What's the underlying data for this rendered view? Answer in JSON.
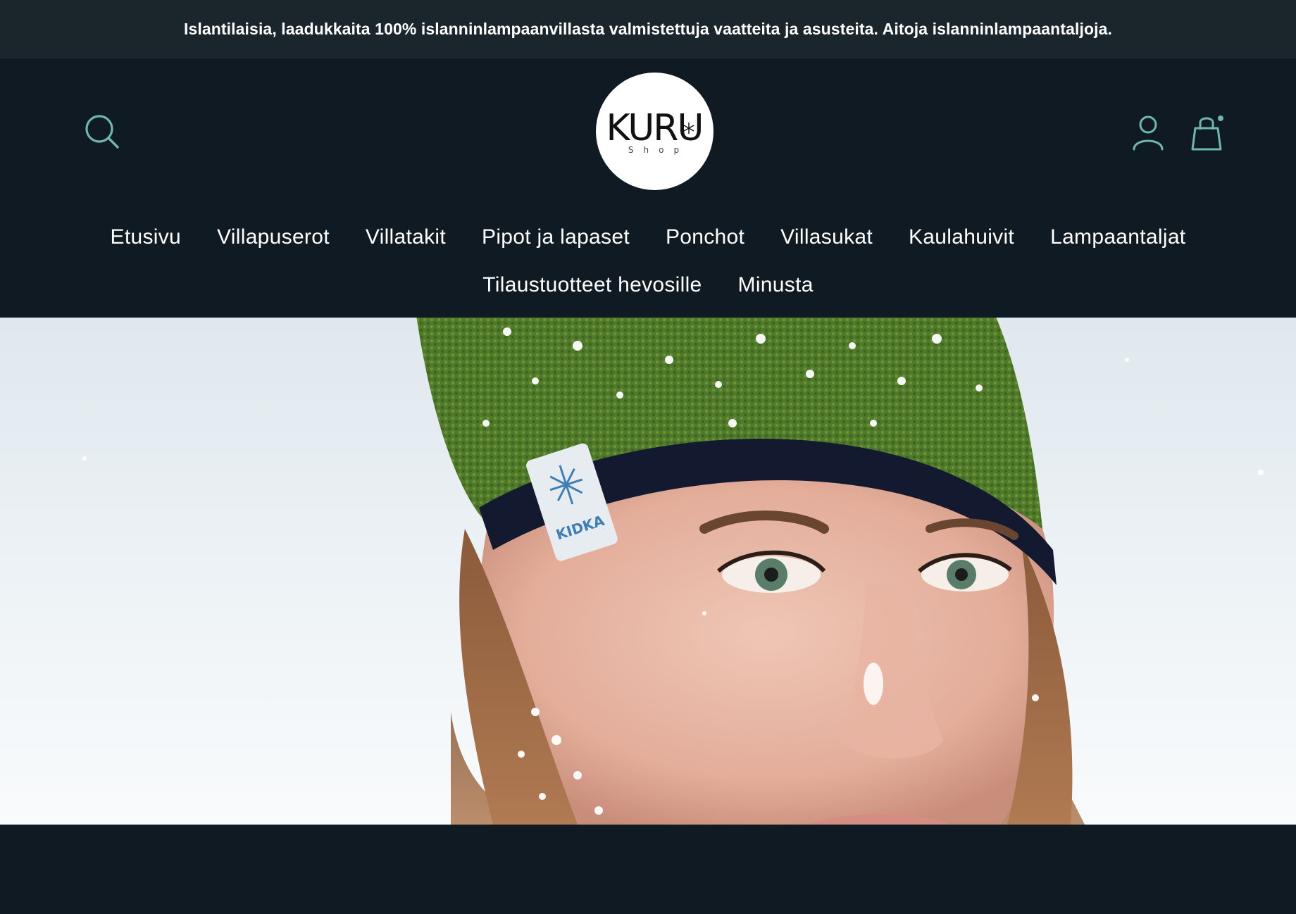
{
  "announcement": {
    "text": "Islantilaisia, laadukkaita 100% islanninlampaanvillasta valmistettuja vaatteita ja asusteita. Aitoja islanninlampaantaljoja."
  },
  "header": {
    "logo": {
      "brand": "KURU",
      "sub": "Shop",
      "icon": "snowflake-icon"
    },
    "icons": {
      "search": "search-icon",
      "account": "account-icon",
      "cart": "cart-icon"
    },
    "colors": {
      "background": "#101a22",
      "announcement_bg": "#1b252c",
      "accent": "#6fb5b0"
    }
  },
  "nav": {
    "row1": [
      {
        "label": "Etusivu"
      },
      {
        "label": "Villapuserot"
      },
      {
        "label": "Villatakit"
      },
      {
        "label": "Pipot ja lapaset"
      },
      {
        "label": "Ponchot"
      },
      {
        "label": "Villasukat"
      },
      {
        "label": "Kaulahuivit"
      },
      {
        "label": "Lampaantaljat"
      }
    ],
    "row2": [
      {
        "label": "Tilaustuotteet hevosille"
      },
      {
        "label": "Minusta"
      }
    ]
  },
  "hero": {
    "image": "woman-wearing-green-knit-beanie-in-snow",
    "beanie_label": "KIDKA"
  }
}
